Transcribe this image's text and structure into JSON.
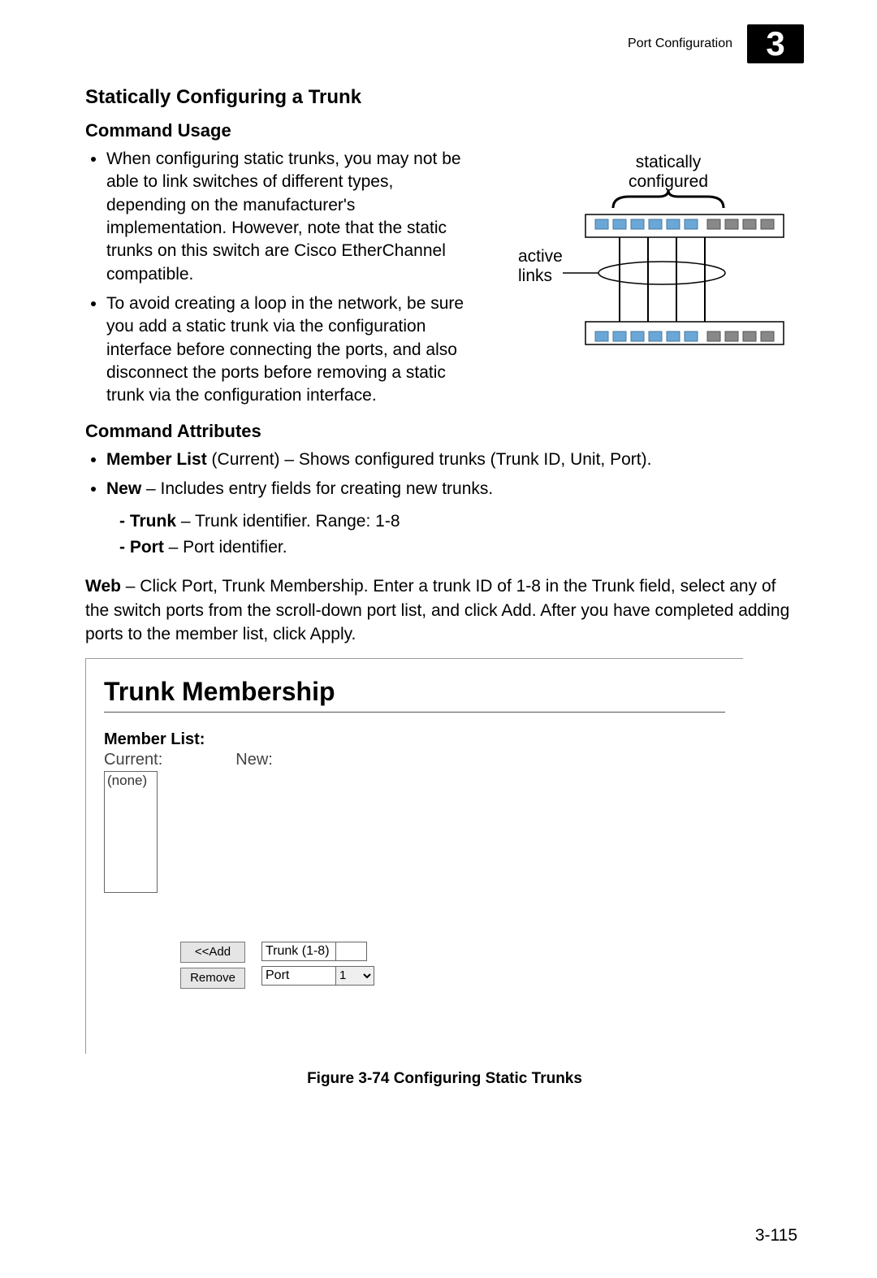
{
  "header": {
    "title": "Port Configuration",
    "chapter": "3"
  },
  "section_heading": "Statically Configuring a Trunk",
  "command_usage_heading": "Command Usage",
  "usage_bullets": [
    "When configuring static trunks, you may not be able to link switches of different types, depending on the manufacturer's implementation. However, note that the static trunks on this switch are Cisco EtherChannel compatible.",
    "To avoid creating a loop in the network, be sure you add a static trunk via the configuration interface before connecting the ports, and also disconnect the ports before removing a static trunk via the configuration interface."
  ],
  "diagram": {
    "label_top": "statically",
    "label_top2": "configured",
    "label_left1": "active",
    "label_left2": "links"
  },
  "command_attr_heading": "Command Attributes",
  "attr_bullets": {
    "member_list_bold": "Member List",
    "member_list_rest": " (Current) – Shows configured trunks (Trunk ID, Unit, Port).",
    "new_bold": "New",
    "new_rest": " – Includes entry fields for creating new trunks.",
    "trunk_bold": "Trunk",
    "trunk_rest": " – Trunk identifier. Range: 1-8",
    "port_bold": "Port",
    "port_rest": " – Port identifier."
  },
  "web_para": {
    "web_bold": "Web",
    "rest": " – Click Port, Trunk Membership. Enter a trunk ID of 1-8 in the Trunk field, select any of the switch ports from the scroll-down port list, and click Add. After you have completed adding ports to the member list, click Apply."
  },
  "panel": {
    "title": "Trunk Membership",
    "member_list": "Member List:",
    "current": "Current:",
    "new": "New:",
    "none": "(none)",
    "add_btn": "<<Add",
    "remove_btn": "Remove",
    "trunk_label": "Trunk (1-8)",
    "trunk_value": "",
    "port_label": "Port",
    "port_value": "1"
  },
  "figure_caption": "Figure 3-74  Configuring Static Trunks",
  "page_number": "3-115"
}
